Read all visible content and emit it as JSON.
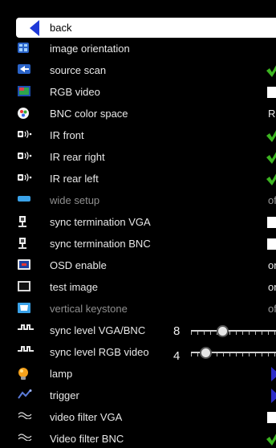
{
  "menu": {
    "back_label": "back",
    "items": [
      {
        "label": "image orientation",
        "icon": "image-orientation-icon",
        "enabled": true,
        "control": "none"
      },
      {
        "label": "source scan",
        "icon": "source-scan-icon",
        "enabled": true,
        "control": "check",
        "checked": true
      },
      {
        "label": "RGB video",
        "icon": "rgb-video-icon",
        "enabled": true,
        "control": "checkbox",
        "checked": false
      },
      {
        "label": "BNC color space",
        "icon": "color-space-icon",
        "enabled": true,
        "control": "text",
        "value": "RGB"
      },
      {
        "label": "IR front",
        "icon": "ir-sensor-icon",
        "enabled": true,
        "control": "check",
        "checked": true
      },
      {
        "label": "IR rear right",
        "icon": "ir-sensor-icon",
        "enabled": true,
        "control": "check",
        "checked": true
      },
      {
        "label": "IR rear left",
        "icon": "ir-sensor-icon",
        "enabled": true,
        "control": "check",
        "checked": true
      },
      {
        "label": "wide setup",
        "icon": "wide-setup-icon",
        "enabled": false,
        "control": "text",
        "value": "off"
      },
      {
        "label": "sync termination VGA",
        "icon": "sync-termination-icon",
        "enabled": true,
        "control": "checkbox",
        "checked": false
      },
      {
        "label": "sync termination BNC",
        "icon": "sync-termination-icon",
        "enabled": true,
        "control": "checkbox",
        "checked": false
      },
      {
        "label": "OSD enable",
        "icon": "osd-icon",
        "enabled": true,
        "control": "text",
        "value": "on"
      },
      {
        "label": "test image",
        "icon": "test-image-icon",
        "enabled": true,
        "control": "text",
        "value": "on"
      },
      {
        "label": "vertical keystone",
        "icon": "keystone-icon",
        "enabled": false,
        "control": "text",
        "value": "off"
      },
      {
        "label": "sync level VGA/BNC",
        "icon": "sync-level-icon",
        "enabled": true,
        "control": "slider",
        "value": "8",
        "level": 0.37
      },
      {
        "label": "sync level RGB video",
        "icon": "sync-level-icon",
        "enabled": true,
        "control": "slider",
        "value": "4",
        "level": 0.17
      },
      {
        "label": "lamp",
        "icon": "lamp-icon",
        "enabled": true,
        "control": "submenu"
      },
      {
        "label": "trigger",
        "icon": "trigger-icon",
        "enabled": true,
        "control": "submenu"
      },
      {
        "label": "video filter VGA",
        "icon": "video-filter-icon",
        "enabled": true,
        "control": "checkbox",
        "checked": false
      },
      {
        "label": "Video filter BNC",
        "icon": "video-filter-icon",
        "enabled": true,
        "control": "check",
        "checked": true
      }
    ]
  },
  "colors": {
    "panel_bg": "#000000",
    "highlight": "#ffffff",
    "check_green": "#3cb521",
    "submenu_arrow": "#2c2cc8",
    "back_arrow": "#1f3ad8"
  }
}
